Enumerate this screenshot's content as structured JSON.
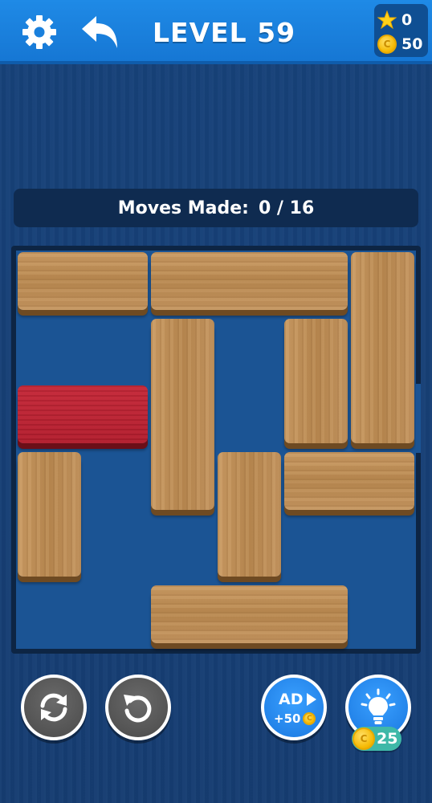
{
  "header": {
    "title": "LEVEL 59",
    "settings_icon": "gear-icon",
    "back_icon": "undo-arrow-icon",
    "stars": "0",
    "coins": "50",
    "coin_glyph": "C"
  },
  "moves": {
    "label": "Moves Made:",
    "value": "0 / 16"
  },
  "board": {
    "rows": 6,
    "cols": 6,
    "exit_row": 3,
    "blocks": [
      {
        "id": "h1",
        "orientation": "horizontal",
        "row": 1,
        "col": 1,
        "length": 2,
        "color": "wood"
      },
      {
        "id": "h2",
        "orientation": "horizontal",
        "row": 1,
        "col": 3,
        "length": 3,
        "color": "wood"
      },
      {
        "id": "v1",
        "orientation": "vertical",
        "row": 1,
        "col": 6,
        "length": 3,
        "color": "wood"
      },
      {
        "id": "v2",
        "orientation": "vertical",
        "row": 2,
        "col": 3,
        "length": 3,
        "color": "wood"
      },
      {
        "id": "v3",
        "orientation": "vertical",
        "row": 2,
        "col": 5,
        "length": 2,
        "color": "wood"
      },
      {
        "id": "red",
        "orientation": "horizontal",
        "row": 3,
        "col": 1,
        "length": 2,
        "color": "red"
      },
      {
        "id": "v4",
        "orientation": "vertical",
        "row": 4,
        "col": 1,
        "length": 2,
        "color": "wood"
      },
      {
        "id": "v5",
        "orientation": "vertical",
        "row": 4,
        "col": 4,
        "length": 2,
        "color": "wood"
      },
      {
        "id": "h3",
        "orientation": "horizontal",
        "row": 4,
        "col": 5,
        "length": 2,
        "color": "wood"
      },
      {
        "id": "h4",
        "orientation": "horizontal",
        "row": 6,
        "col": 3,
        "length": 3,
        "color": "wood"
      }
    ]
  },
  "buttons": {
    "restart_icon": "restart-arrows-icon",
    "undo_icon": "undo-circle-icon",
    "ad_label": "AD",
    "ad_reward": "+50",
    "hint_icon": "lightbulb-icon",
    "hint_cost": "25"
  },
  "colors": {
    "topbar": "#1f8ae6",
    "board": "#1b5494",
    "wood": "#c49560",
    "red_block": "#b01e2e",
    "coin": "#f5b800",
    "hint_badge": "#3fb8a8"
  }
}
